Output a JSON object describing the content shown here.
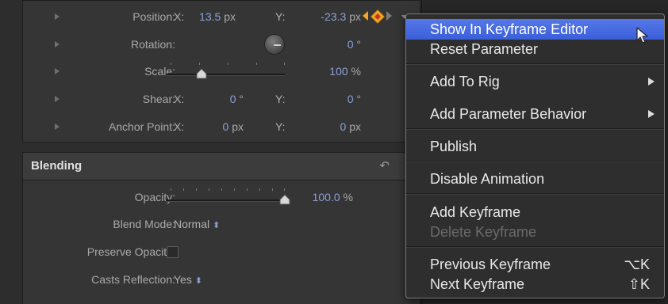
{
  "transform": {
    "position": {
      "label": "Position:",
      "x_label": "X:",
      "x_value": "13.5",
      "x_unit": "px",
      "y_label": "Y:",
      "y_value": "-23.3",
      "y_unit": "px"
    },
    "rotation": {
      "label": "Rotation:",
      "value": "0",
      "unit": "°"
    },
    "scale": {
      "label": "Scale:",
      "value": "100",
      "unit": "%",
      "level": 0.3
    },
    "shear": {
      "label": "Shear:",
      "x_label": "X:",
      "x_value": "0",
      "x_unit": "°",
      "y_label": "Y:",
      "y_value": "0",
      "y_unit": "°"
    },
    "anchor_point": {
      "label": "Anchor Point:",
      "x_label": "X:",
      "x_value": "0",
      "x_unit": "px",
      "y_label": "Y:",
      "y_value": "0",
      "y_unit": "px"
    }
  },
  "blending": {
    "title": "Blending",
    "opacity": {
      "label": "Opacity:",
      "value": "100.0",
      "unit": "%",
      "level": 1.0
    },
    "blend_mode": {
      "label": "Blend Mode:",
      "value": "Normal"
    },
    "preserve_opacity": {
      "label": "Preserve Opacity:",
      "checked": false
    },
    "casts_reflection": {
      "label": "Casts Reflection:",
      "value": "Yes"
    }
  },
  "context_menu": {
    "items": [
      {
        "label": "Show In Keyframe Editor",
        "highlighted": true
      },
      {
        "label": "Reset Parameter"
      },
      {
        "label": "Add To Rig",
        "submenu": true
      },
      {
        "label": "Add Parameter Behavior",
        "submenu": true
      },
      {
        "label": "Publish"
      },
      {
        "label": "Disable Animation"
      },
      {
        "label": "Add Keyframe"
      },
      {
        "label": "Delete Keyframe",
        "disabled": true
      },
      {
        "label": "Previous Keyframe",
        "shortcut": "⌥K"
      },
      {
        "label": "Next Keyframe",
        "shortcut": "⇧K"
      }
    ]
  },
  "colors": {
    "value_text": "#8da0d6",
    "menu_highlight": "#3a5fd9",
    "keyframe_diamond": "#f2a526"
  }
}
